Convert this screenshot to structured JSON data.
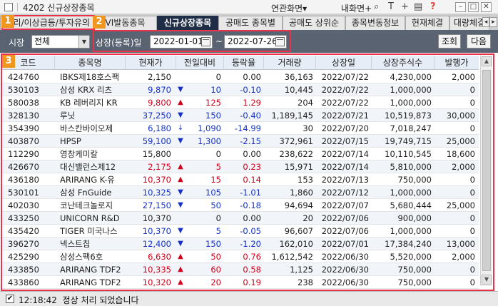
{
  "titlebar": {
    "title": "4202 신규상장종목",
    "linked_screen": "연관화면",
    "my_screen": "내화면",
    "icons": [
      "plus-icon",
      "search-icon",
      "text-icon",
      "plus-icon",
      "print-icon",
      "help-icon"
    ],
    "window_buttons": [
      "minimize",
      "restore",
      "close"
    ]
  },
  "tabs": [
    {
      "label": "관리/이상급등/투자유의",
      "active": false
    },
    {
      "label": "VI발동종목",
      "active": false
    },
    {
      "label": "신규상장종목",
      "active": true
    },
    {
      "label": "공매도 종목별",
      "active": false
    },
    {
      "label": "공매도 상위순",
      "active": false
    },
    {
      "label": "종목변동정보",
      "active": false
    },
    {
      "label": "현재체결",
      "active": false
    },
    {
      "label": "대량체결",
      "active": false
    }
  ],
  "toolbar": {
    "market_label": "시장",
    "market_value": "전체",
    "date_label": "상장(등록)일",
    "start_date": "2022-01-01",
    "end_date": "2022-07-26",
    "tilde": "~",
    "query_button": "조회",
    "next_button": "다음"
  },
  "markers": [
    "1",
    "2",
    "3"
  ],
  "table": {
    "headers": [
      "코드",
      "종목명",
      "현재가",
      "전일대비",
      "등락율",
      "거래량",
      "상장일",
      "상장주식수",
      "발행가"
    ],
    "rows": [
      {
        "code": "424760",
        "name": "IBKS제18호스팩",
        "price": "2,150",
        "dir": "flat",
        "sign": "",
        "change": "0",
        "rate": "0.00",
        "volume": "36,163",
        "date": "2022/07/22",
        "shares": "4,230,000",
        "issue": "2,000"
      },
      {
        "code": "530103",
        "name": "삼성 KRX 리츠",
        "price": "9,870",
        "dir": "down",
        "sign": "▼",
        "change": "10",
        "rate": "-0.10",
        "volume": "10,445",
        "date": "2022/07/22",
        "shares": "1,000,000",
        "issue": "0"
      },
      {
        "code": "580038",
        "name": "KB 레버리지 KR",
        "price": "9,800",
        "dir": "up",
        "sign": "▲",
        "change": "125",
        "rate": "1.29",
        "volume": "204",
        "date": "2022/07/22",
        "shares": "1,000,000",
        "issue": "0"
      },
      {
        "code": "328130",
        "name": "루닛",
        "price": "37,250",
        "dir": "down",
        "sign": "▼",
        "change": "150",
        "rate": "-0.40",
        "volume": "1,189,145",
        "date": "2022/07/21",
        "shares": "10,519,873",
        "issue": "30,000"
      },
      {
        "code": "354390",
        "name": "바스칸바이오제",
        "price": "6,180",
        "dir": "down",
        "sign": "↓",
        "change": "1,090",
        "rate": "-14.99",
        "volume": "30",
        "date": "2022/07/20",
        "shares": "7,018,247",
        "issue": "0"
      },
      {
        "code": "403870",
        "name": "HPSP",
        "price": "59,100",
        "dir": "down",
        "sign": "▼",
        "change": "1,300",
        "rate": "-2.15",
        "volume": "372,961",
        "date": "2022/07/15",
        "shares": "19,749,715",
        "issue": "25,000"
      },
      {
        "code": "112290",
        "name": "영창케미칼",
        "price": "15,800",
        "dir": "flat",
        "sign": "",
        "change": "0",
        "rate": "0.00",
        "volume": "238,622",
        "date": "2022/07/14",
        "shares": "10,110,545",
        "issue": "18,600"
      },
      {
        "code": "426670",
        "name": "대신밸런스제12",
        "price": "2,175",
        "dir": "up",
        "sign": "▲",
        "change": "5",
        "rate": "0.23",
        "volume": "15,971",
        "date": "2022/07/14",
        "shares": "5,810,000",
        "issue": "2,000"
      },
      {
        "code": "436180",
        "name": "ARIRANG K-유",
        "price": "10,370",
        "dir": "up",
        "sign": "▲",
        "change": "15",
        "rate": "0.14",
        "volume": "153",
        "date": "2022/07/13",
        "shares": "750,000",
        "issue": "0"
      },
      {
        "code": "530101",
        "name": "삼성 FnGuide",
        "price": "10,325",
        "dir": "down",
        "sign": "▼",
        "change": "105",
        "rate": "-1.01",
        "volume": "1,860",
        "date": "2022/07/12",
        "shares": "1,000,000",
        "issue": "0"
      },
      {
        "code": "402030",
        "name": "코난테크놀로지",
        "price": "27,150",
        "dir": "down",
        "sign": "▼",
        "change": "50",
        "rate": "-0.18",
        "volume": "94,694",
        "date": "2022/07/07",
        "shares": "5,680,444",
        "issue": "25,000"
      },
      {
        "code": "433250",
        "name": "UNICORN R&D",
        "price": "10,370",
        "dir": "flat",
        "sign": "",
        "change": "0",
        "rate": "0.00",
        "volume": "20",
        "date": "2022/07/06",
        "shares": "900,000",
        "issue": "0"
      },
      {
        "code": "435420",
        "name": "TIGER 미국나스",
        "price": "10,370",
        "dir": "down",
        "sign": "▼",
        "change": "5",
        "rate": "-0.05",
        "volume": "96,607",
        "date": "2022/07/06",
        "shares": "1,000,000",
        "issue": "0"
      },
      {
        "code": "396270",
        "name": "넥스트칩",
        "price": "12,400",
        "dir": "down",
        "sign": "▼",
        "change": "150",
        "rate": "-1.20",
        "volume": "162,010",
        "date": "2022/07/01",
        "shares": "17,384,240",
        "issue": "13,000"
      },
      {
        "code": "425290",
        "name": "삼성스팩6호",
        "price": "6,630",
        "dir": "up",
        "sign": "▲",
        "change": "50",
        "rate": "0.76",
        "volume": "1,612,542",
        "date": "2022/06/30",
        "shares": "5,520,000",
        "issue": "2,000"
      },
      {
        "code": "433850",
        "name": "ARIRANG TDF2",
        "price": "10,335",
        "dir": "up",
        "sign": "▲",
        "change": "60",
        "rate": "0.58",
        "volume": "1,125",
        "date": "2022/06/30",
        "shares": "750,000",
        "issue": "0"
      },
      {
        "code": "433860",
        "name": "ARIRANG TDF2",
        "price": "10,320",
        "dir": "up",
        "sign": "▲",
        "change": "20",
        "rate": "0.19",
        "volume": "238",
        "date": "2022/06/30",
        "shares": "750,000",
        "issue": "0"
      }
    ]
  },
  "status": {
    "time": "12:18:42",
    "message": "정상 처리 되었습니다"
  },
  "colors": {
    "up": "#d0021b",
    "down": "#1432c8",
    "active_tab": "#1f2d47",
    "toolbar_bg": "#5a6372",
    "highlight": "#e8334a",
    "marker": "#f0951d"
  }
}
